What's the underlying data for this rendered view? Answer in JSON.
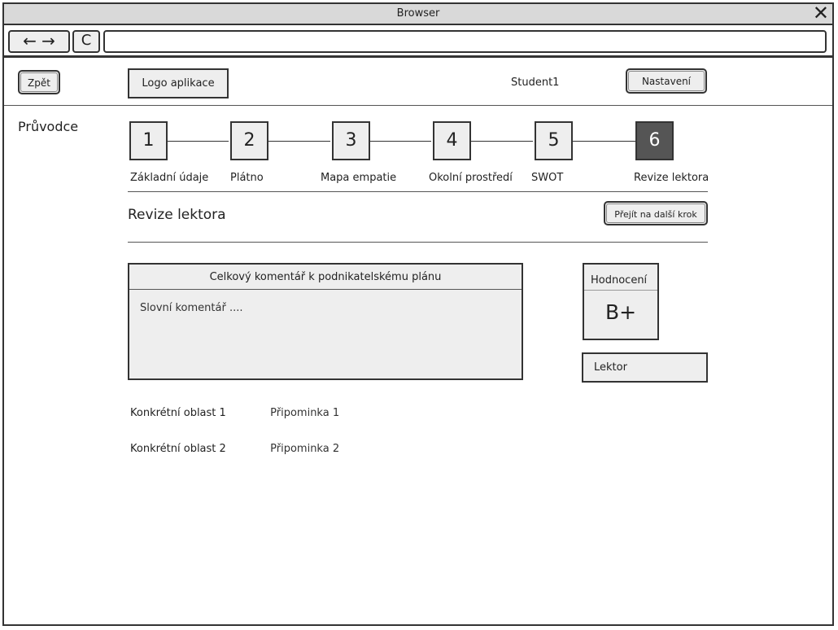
{
  "browser": {
    "title": "Browser",
    "close_icon": "✕",
    "back_forward_glyph": "← →",
    "reload_glyph": "C",
    "url": ""
  },
  "header": {
    "back_label": "Zpět",
    "logo_label": "Logo aplikace",
    "user_name": "Student1",
    "settings_label": "Nastavení"
  },
  "sidebar": {
    "title": "Průvodce"
  },
  "steps": [
    {
      "number": "1",
      "label": "Základní údaje",
      "active": false
    },
    {
      "number": "2",
      "label": "Plátno",
      "active": false
    },
    {
      "number": "3",
      "label": "Mapa empatie",
      "active": false
    },
    {
      "number": "4",
      "label": "Okolní prostředí",
      "active": false
    },
    {
      "number": "5",
      "label": "SWOT",
      "active": false
    },
    {
      "number": "6",
      "label": "Revize lektora",
      "active": true
    }
  ],
  "section": {
    "title": "Revize lektora",
    "next_step_label": "Přejít na další krok"
  },
  "comment": {
    "header": "Celkový komentář k podnikatelskému plánu",
    "body": "Slovní komentář ...."
  },
  "grade": {
    "label": "Hodnocení",
    "value": "B+"
  },
  "lecturer": {
    "label": "Lektor"
  },
  "details": [
    {
      "area": "Konkrétní oblast 1",
      "note": "Připominka 1"
    },
    {
      "area": "Konkrétní oblast 2",
      "note": "Připominka 2"
    }
  ],
  "colors": {
    "active_step": "#555555",
    "panel_fill": "#eeeeee",
    "border": "#333333"
  }
}
